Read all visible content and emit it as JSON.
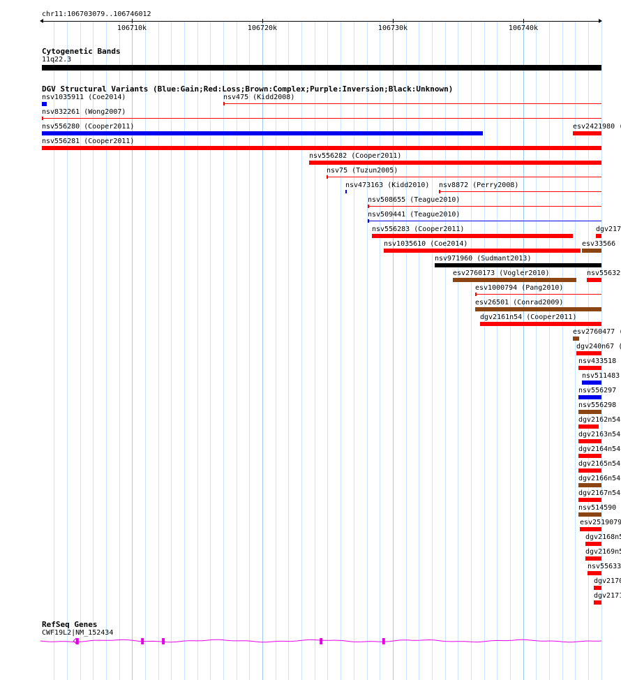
{
  "region": "chr11:106703079..106746012",
  "ruler": {
    "ticks": [
      {
        "pos": 106710000,
        "label": "106710k"
      },
      {
        "pos": 106720000,
        "label": "106720k"
      },
      {
        "pos": 106730000,
        "label": "106730k"
      },
      {
        "pos": 106740000,
        "label": "106740k"
      }
    ],
    "start": 106703079,
    "end": 106746012
  },
  "tracks": {
    "cytoband_title": "Cytogenetic Bands",
    "cytoband_label": "11q22.3",
    "dgv_title": "DGV Structural Variants (Blue:Gain;Red:Loss;Brown:Complex;Purple:Inversion;Black:Unknown)",
    "refseq_title": "RefSeq Genes",
    "gene_label": "CWF19L2|NM_152434"
  },
  "colors": {
    "gain": "#0000ee",
    "loss": "#ff0000",
    "complex": "#8b4513",
    "unknown": "#000000",
    "gene": "#e600e6",
    "grid": "#c8e6ff"
  },
  "variants": [
    {
      "label": "nsv1035911 (Coe2014)",
      "start": 106703079,
      "end": 106703450,
      "type": "gain",
      "thick": "thick"
    },
    {
      "label": "nsv475 (Kidd2008)",
      "start": 106717000,
      "end": 106746012,
      "type": "loss",
      "thick": "thin"
    },
    {
      "label": "nsv832261 (Wong2007)",
      "start": 106703079,
      "end": 106746012,
      "type": "loss",
      "thick": "thin"
    },
    {
      "label": "nsv556280 (Cooper2011)",
      "start": 106703079,
      "end": 106736900,
      "type": "gain",
      "thick": "thick"
    },
    {
      "label": "esv2421980 (",
      "start": 106743800,
      "end": 106746012,
      "type": "loss",
      "thick": "thick"
    },
    {
      "label": "nsv556281 (Cooper2011)",
      "start": 106703079,
      "end": 106746012,
      "type": "loss",
      "thick": "thick"
    },
    {
      "label": "nsv556282 (Cooper2011)",
      "start": 106723600,
      "end": 106746012,
      "type": "loss",
      "thick": "thick"
    },
    {
      "label": "nsv75 (Tuzun2005)",
      "start": 106724900,
      "end": 106746012,
      "type": "loss",
      "thick": "thin"
    },
    {
      "label": "nsv473163 (Kidd2010)",
      "start": 106726350,
      "end": 106726420,
      "type": "gain",
      "thick": "thin"
    },
    {
      "label": "nsv8872 (Perry2008)",
      "start": 106733550,
      "end": 106746012,
      "type": "loss",
      "thick": "thin"
    },
    {
      "label": "nsv508655 (Teague2010)",
      "start": 106728100,
      "end": 106746012,
      "type": "loss",
      "thick": "thin"
    },
    {
      "label": "nsv509441 (Teague2010)",
      "start": 106728100,
      "end": 106746012,
      "type": "gain",
      "thick": "thin"
    },
    {
      "label": "nsv556283 (Cooper2011)",
      "start": 106728400,
      "end": 106743800,
      "type": "loss",
      "thick": "thick"
    },
    {
      "label": "dgv217",
      "start": 106745600,
      "end": 106746012,
      "type": "loss",
      "thick": "thick"
    },
    {
      "label": "nsv1035610 (Coe2014)",
      "start": 106729300,
      "end": 106744400,
      "type": "loss",
      "thick": "thick"
    },
    {
      "label": "esv33566",
      "start": 106744500,
      "end": 106746012,
      "type": "complex",
      "thick": "thick"
    },
    {
      "label": "nsv971960 (Sudmant2013)",
      "start": 106733200,
      "end": 106746012,
      "type": "unknown",
      "thick": "thick"
    },
    {
      "label": "esv2760173 (Vogler2010)",
      "start": 106734600,
      "end": 106744100,
      "type": "complex",
      "thick": "thick"
    },
    {
      "label": "nsv556329",
      "start": 106744900,
      "end": 106746012,
      "type": "loss",
      "thick": "thick"
    },
    {
      "label": "esv1000794 (Pang2010)",
      "start": 106736300,
      "end": 106746012,
      "type": "loss",
      "thick": "thin"
    },
    {
      "label": "esv26501 (Conrad2009)",
      "start": 106736300,
      "end": 106746012,
      "type": "complex",
      "thick": "thick"
    },
    {
      "label": "dgv2161n54 (Cooper2011)",
      "start": 106736700,
      "end": 106746012,
      "type": "loss",
      "thick": "thick"
    },
    {
      "label": "esv2760477 (",
      "start": 106743800,
      "end": 106744300,
      "type": "complex",
      "thick": "thick"
    },
    {
      "label": "dgv240n67 (",
      "start": 106744100,
      "end": 106746012,
      "type": "loss",
      "thick": "thick"
    },
    {
      "label": "nsv433518 (",
      "start": 106744250,
      "end": 106746012,
      "type": "loss",
      "thick": "thick"
    },
    {
      "label": "nsv511483 (",
      "start": 106744500,
      "end": 106746012,
      "type": "gain",
      "thick": "thick"
    },
    {
      "label": "nsv556297 (",
      "start": 106744250,
      "end": 106746012,
      "type": "gain",
      "thick": "thick"
    },
    {
      "label": "nsv556298 (",
      "start": 106744250,
      "end": 106746012,
      "type": "complex",
      "thick": "thick"
    },
    {
      "label": "dgv2162n54",
      "start": 106744250,
      "end": 106745800,
      "type": "loss",
      "thick": "thick"
    },
    {
      "label": "dgv2163n54",
      "start": 106744250,
      "end": 106746012,
      "type": "loss",
      "thick": "thick"
    },
    {
      "label": "dgv2164n54",
      "start": 106744250,
      "end": 106746012,
      "type": "loss",
      "thick": "thick"
    },
    {
      "label": "dgv2165n54",
      "start": 106744250,
      "end": 106746012,
      "type": "loss",
      "thick": "thick"
    },
    {
      "label": "dgv2166n54",
      "start": 106744250,
      "end": 106746012,
      "type": "complex",
      "thick": "thick"
    },
    {
      "label": "dgv2167n54",
      "start": 106744250,
      "end": 106746012,
      "type": "loss",
      "thick": "thick"
    },
    {
      "label": "nsv514590",
      "start": 106744250,
      "end": 106746012,
      "type": "complex",
      "thick": "thick"
    },
    {
      "label": "esv2519079",
      "start": 106744350,
      "end": 106746012,
      "type": "loss",
      "thick": "thick"
    },
    {
      "label": "dgv2168n5",
      "start": 106744800,
      "end": 106746012,
      "type": "loss",
      "thick": "thick"
    },
    {
      "label": "dgv2169n5",
      "start": 106744800,
      "end": 106746012,
      "type": "loss",
      "thick": "thick"
    },
    {
      "label": "nsv55633",
      "start": 106744950,
      "end": 106746012,
      "type": "loss",
      "thick": "thick"
    },
    {
      "label": "dgv2170",
      "start": 106745400,
      "end": 106746012,
      "type": "loss",
      "thick": "thick"
    },
    {
      "label": "dgv2171",
      "start": 106745400,
      "end": 106746012,
      "type": "loss",
      "thick": "thick"
    }
  ],
  "gene": {
    "exons": [
      106705800,
      106710800,
      106712400,
      106724500,
      106729300
    ]
  }
}
